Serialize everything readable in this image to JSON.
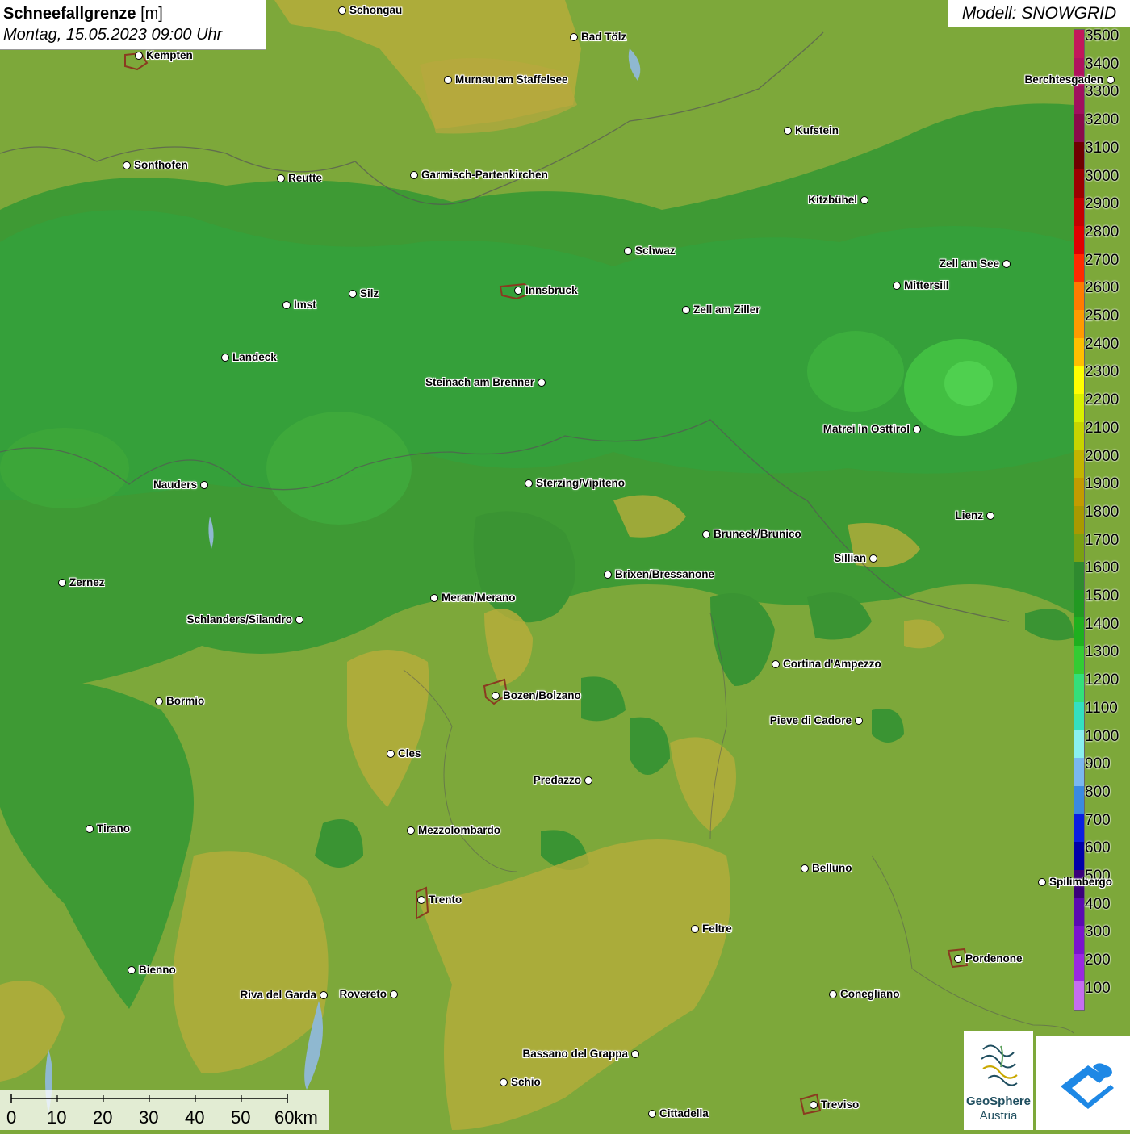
{
  "header": {
    "title": "Schneefallgrenze",
    "unit": "[m]",
    "datetime": "Montag, 15.05.2023 09:00 Uhr"
  },
  "model": {
    "label": "Modell: SNOWGRID"
  },
  "legend": {
    "ticks": [
      "3500",
      "3400",
      "3300",
      "3200",
      "3100",
      "3000",
      "2900",
      "2800",
      "2700",
      "2600",
      "2500",
      "2400",
      "2300",
      "2200",
      "2100",
      "2000",
      "1900",
      "1800",
      "1700",
      "1600",
      "1500",
      "1400",
      "1300",
      "1200",
      "1100",
      "1000",
      "900",
      "800",
      "700",
      "600",
      "500",
      "400",
      "300",
      "200",
      "100"
    ],
    "colors": [
      "#c2185b",
      "#b0135e",
      "#a0105e",
      "#8a0a4a",
      "#6e0000",
      "#9b0000",
      "#c40000",
      "#e00000",
      "#ff2a00",
      "#ff7b00",
      "#ff9a00",
      "#ffbf00",
      "#ffff00",
      "#d8f000",
      "#c7d400",
      "#c2b400",
      "#c29b00",
      "#a89900",
      "#7aa012",
      "#2f8a2f",
      "#229922",
      "#1fb01f",
      "#33cc33",
      "#33e07a",
      "#33e0c0",
      "#8af0f0",
      "#7ab8f0",
      "#3a8ae0",
      "#0a1ee0",
      "#0000a8",
      "#3a007a",
      "#5a0ab0",
      "#7a14cc",
      "#9a28e0",
      "#c56ef0"
    ]
  },
  "scalebar": {
    "labels": [
      "0",
      "10",
      "20",
      "30",
      "40",
      "50",
      "60km"
    ]
  },
  "logos": {
    "geosphere_line1": "GeoSphere",
    "geosphere_line2": "Austria"
  },
  "cities": [
    {
      "name": "Schongau"
    },
    {
      "name": "Kempten"
    },
    {
      "name": "Bad Tölz"
    },
    {
      "name": "Murnau am Staffelsee"
    },
    {
      "name": "Berchtesgaden"
    },
    {
      "name": "Kufstein"
    },
    {
      "name": "Sonthofen"
    },
    {
      "name": "Reutte"
    },
    {
      "name": "Garmisch-Partenkirchen"
    },
    {
      "name": "Kitzbühel"
    },
    {
      "name": "Schwaz"
    },
    {
      "name": "Zell am See"
    },
    {
      "name": "Innsbruck"
    },
    {
      "name": "Mittersill"
    },
    {
      "name": "Imst"
    },
    {
      "name": "Silz"
    },
    {
      "name": "Zell am Ziller"
    },
    {
      "name": "Landeck"
    },
    {
      "name": "Steinach am Brenner"
    },
    {
      "name": "Matrei in Osttirol"
    },
    {
      "name": "Nauders"
    },
    {
      "name": "Sterzing/Vipiteno"
    },
    {
      "name": "Lienz"
    },
    {
      "name": "Bruneck/Brunico"
    },
    {
      "name": "Sillian"
    },
    {
      "name": "Brixen/Bressanone"
    },
    {
      "name": "Zernez"
    },
    {
      "name": "Meran/Merano"
    },
    {
      "name": "Schlanders/Silandro"
    },
    {
      "name": "Cortina d'Ampezzo"
    },
    {
      "name": "Bozen/Bolzano"
    },
    {
      "name": "Bormio"
    },
    {
      "name": "Pieve di Cadore"
    },
    {
      "name": "Cles"
    },
    {
      "name": "Predazzo"
    },
    {
      "name": "Tirano"
    },
    {
      "name": "Mezzolombardo"
    },
    {
      "name": "Belluno"
    },
    {
      "name": "Spilimbergo"
    },
    {
      "name": "Trento"
    },
    {
      "name": "Feltre"
    },
    {
      "name": "Pordenone"
    },
    {
      "name": "Bienno"
    },
    {
      "name": "Riva del Garda"
    },
    {
      "name": "Rovereto"
    },
    {
      "name": "Conegliano"
    },
    {
      "name": "Bassano del Grappa"
    },
    {
      "name": "Schio"
    },
    {
      "name": "Treviso"
    },
    {
      "name": "Cittadella"
    }
  ]
}
